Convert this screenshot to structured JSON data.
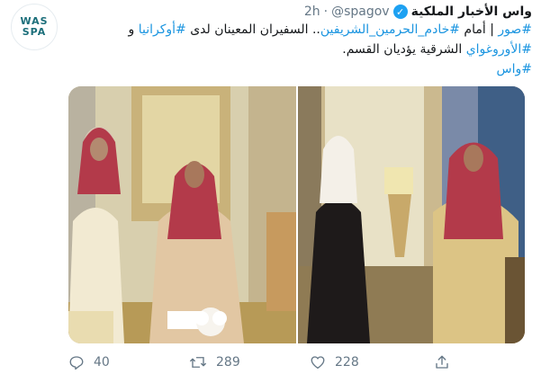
{
  "tweet": {
    "author_name": "واس الأخبار الملكية",
    "handle": "@spagov",
    "separator": "·",
    "time": "2h",
    "avatar_lines": [
      "WAS",
      "SPA"
    ],
    "text_parts": [
      {
        "t": "#صور",
        "tag": true
      },
      {
        "t": " | أمام ",
        "tag": false
      },
      {
        "t": "#خادم_الحرمين_الشريفين",
        "tag": true
      },
      {
        "t": ".. السفيران المعينان لدى ",
        "tag": false
      },
      {
        "t": "#أوكرانيا",
        "tag": true
      },
      {
        "t": " و ",
        "tag": false
      },
      {
        "t": "#الأوروغواي",
        "tag": true
      },
      {
        "t": " الشرقية يؤديان القسم.",
        "tag": false
      },
      {
        "t": "#واس",
        "tag": true
      }
    ],
    "counts": {
      "replies": "40",
      "retweets": "289",
      "likes": "228"
    }
  },
  "colors": {
    "link": "#1b95e0",
    "verified": "#1da1f2",
    "muted": "#657786"
  }
}
